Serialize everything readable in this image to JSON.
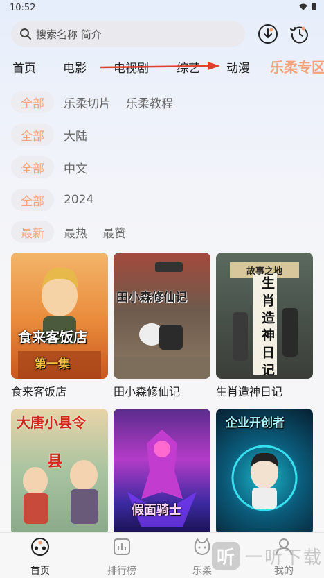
{
  "status": {
    "time": "10:52"
  },
  "search": {
    "placeholder": "搜索名称 简介"
  },
  "tabs": [
    {
      "label": "首页"
    },
    {
      "label": "电影"
    },
    {
      "label": "电视剧"
    },
    {
      "label": "综艺"
    },
    {
      "label": "动漫"
    },
    {
      "label": "乐柔专区"
    }
  ],
  "filters": {
    "row1": {
      "selected": "全部",
      "options": [
        "乐柔切片",
        "乐柔教程"
      ]
    },
    "row2": {
      "selected": "全部",
      "options": [
        "大陆"
      ]
    },
    "row3": {
      "selected": "全部",
      "options": [
        "中文"
      ]
    },
    "row4": {
      "selected": "全部",
      "options": [
        "2024"
      ]
    },
    "row5": {
      "selected": "最新",
      "options": [
        "最热",
        "最赞"
      ]
    }
  },
  "cards": [
    {
      "title": "食来客饭店",
      "poster_text": [
        "食来客饭店",
        "第一集"
      ]
    },
    {
      "title": "田小森修仙记",
      "poster_text": [
        "田小森修仙记"
      ]
    },
    {
      "title": "生肖造神日记",
      "poster_text": [
        "生肖造神日记",
        "故事之地"
      ]
    },
    {
      "title": "",
      "poster_text": [
        "大唐小县令",
        "县"
      ]
    },
    {
      "title": "",
      "poster_text": [
        "假面骑士"
      ]
    },
    {
      "title": "",
      "poster_text": [
        "企业开创者"
      ]
    }
  ],
  "bottom_nav": [
    {
      "label": "首页",
      "icon": "film-reel-icon"
    },
    {
      "label": "排行榜",
      "icon": "chart-icon"
    },
    {
      "label": "乐柔",
      "icon": "cat-face-icon"
    },
    {
      "label": "我的",
      "icon": "user-icon"
    }
  ],
  "watermark": {
    "logo": "听",
    "text": "一听下载"
  },
  "colors": {
    "accent": "#f5a27a",
    "arrow": "#e0402c"
  }
}
